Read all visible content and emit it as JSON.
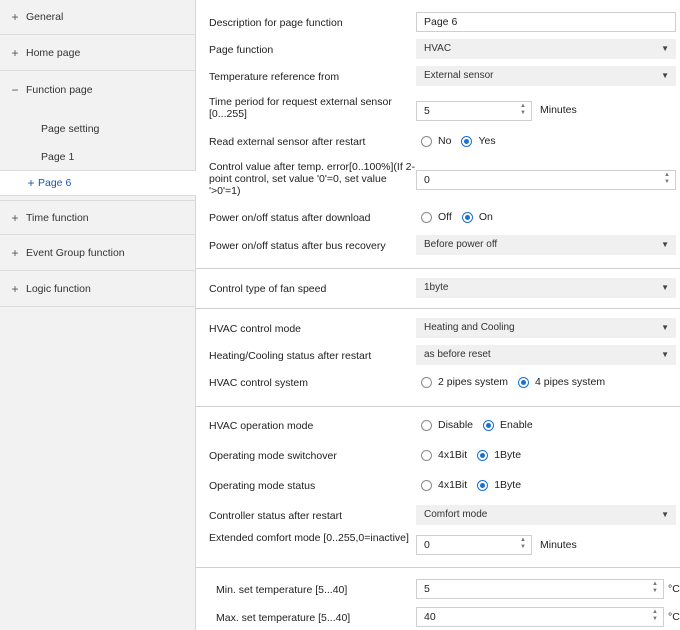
{
  "sidebar": {
    "items": [
      {
        "icon": "+",
        "label": "General"
      },
      {
        "icon": "+",
        "label": "Home page"
      },
      {
        "icon": "−",
        "label": "Function page"
      },
      {
        "icon": "",
        "label": "Page setting"
      },
      {
        "icon": "",
        "label": "Page 1"
      },
      {
        "icon": "+",
        "label": "Page 6"
      },
      {
        "icon": "+",
        "label": "Time function"
      },
      {
        "icon": "+",
        "label": "Event Group function"
      },
      {
        "icon": "+",
        "label": "Logic function"
      }
    ]
  },
  "params": {
    "description": {
      "label": "Description for page function",
      "value": "Page 6"
    },
    "page_function": {
      "label": "Page function",
      "value": "HVAC"
    },
    "temp_ref": {
      "label": "Temperature reference from",
      "value": "External sensor"
    },
    "time_period": {
      "label": "Time period for request external sensor [0...255]",
      "value": "5",
      "unit": "Minutes"
    },
    "read_sensor": {
      "label": "Read external sensor after restart",
      "opt1": "No",
      "opt2": "Yes"
    },
    "control_value": {
      "label": "Control value after temp. error[0..100%](If 2-point control, set value '0'=0, set value '>0'=1)",
      "value": "0"
    },
    "power_download": {
      "label": "Power on/off  status after download",
      "opt1": "Off",
      "opt2": "On"
    },
    "power_bus": {
      "label": "Power on/off  status after bus recovery",
      "value": "Before power off"
    },
    "fan_speed": {
      "label": "Control type of fan speed",
      "value": "1byte"
    },
    "hvac_mode": {
      "label": "HVAC control mode",
      "value": "Heating and Cooling"
    },
    "heat_cool_restart": {
      "label": "Heating/Cooling status after restart",
      "value": "as before reset"
    },
    "hvac_system": {
      "label": "HVAC control system",
      "opt1": "2 pipes system",
      "opt2": "4 pipes system"
    },
    "hvac_op_mode": {
      "label": "HVAC operation mode",
      "opt1": "Disable",
      "opt2": "Enable"
    },
    "op_switchover": {
      "label": "Operating mode switchover",
      "opt1": "4x1Bit",
      "opt2": "1Byte"
    },
    "op_status": {
      "label": "Operating mode status",
      "opt1": "4x1Bit",
      "opt2": "1Byte"
    },
    "controller_status": {
      "label": "Controller status after restart",
      "value": "Comfort mode"
    },
    "extended_comfort": {
      "label": "Extended comfort mode [0..255,0=inactive]",
      "value": "0",
      "unit": "Minutes"
    },
    "min_temp": {
      "label": "Min. set temperature [5...40]",
      "value": "5",
      "unit": "°C"
    },
    "max_temp": {
      "label": "Max. set temperature [5...40]",
      "value": "40",
      "unit": "°C"
    }
  }
}
